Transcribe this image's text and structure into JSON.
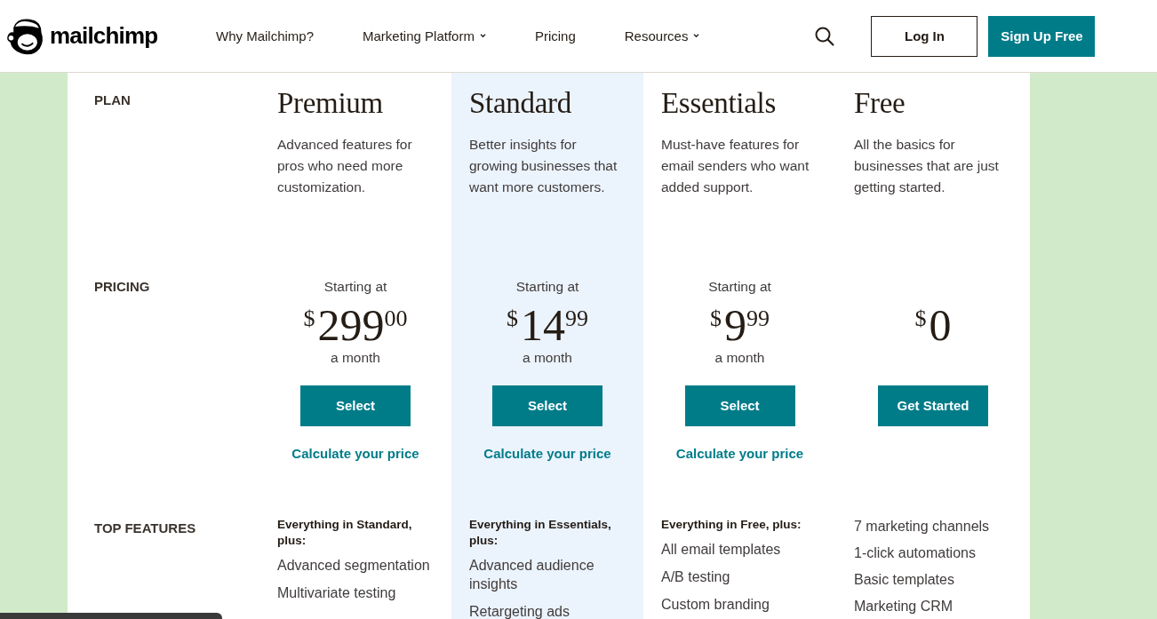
{
  "header": {
    "brand": "mailchimp",
    "nav": [
      {
        "label": "Why Mailchimp?",
        "dropdown": false
      },
      {
        "label": "Marketing Platform",
        "dropdown": true
      },
      {
        "label": "Pricing",
        "dropdown": false
      },
      {
        "label": "Resources",
        "dropdown": true
      }
    ],
    "login": "Log In",
    "signup": "Sign Up Free"
  },
  "sections": {
    "plan": "PLAN",
    "pricing": "PRICING",
    "features": "TOP FEATURES"
  },
  "plans": [
    {
      "name": "Premium",
      "highlighted": false,
      "description": "Advanced features for pros who need more customization.",
      "starting": "Starting at",
      "currency": "$",
      "amount": "299",
      "cents": "00",
      "period": "a month",
      "button": "Select",
      "calculate": "Calculate your price",
      "intro": "Everything in Standard, plus:",
      "features": [
        "Advanced segmentation",
        "Multivariate testing"
      ]
    },
    {
      "name": "Standard",
      "highlighted": true,
      "description": "Better insights for growing businesses that want more customers.",
      "starting": "Starting at",
      "currency": "$",
      "amount": "14",
      "cents": "99",
      "period": "a month",
      "button": "Select",
      "calculate": "Calculate your price",
      "intro": "Everything in Essentials, plus:",
      "features": [
        "Advanced audience insights",
        "Retargeting ads"
      ]
    },
    {
      "name": "Essentials",
      "highlighted": false,
      "description": "Must-have features for email senders who want added support.",
      "starting": "Starting at",
      "currency": "$",
      "amount": "9",
      "cents": "99",
      "period": "a month",
      "button": "Select",
      "calculate": "Calculate your price",
      "intro": "Everything in Free, plus:",
      "features": [
        "All email templates",
        "A/B testing",
        "Custom branding"
      ]
    },
    {
      "name": "Free",
      "highlighted": false,
      "description": "All the basics for businesses that are just getting started.",
      "currency": "$",
      "amount": "0",
      "button": "Get Started",
      "features": [
        "7 marketing channels",
        "1-click automations",
        "Basic templates",
        "Marketing CRM"
      ]
    }
  ]
}
